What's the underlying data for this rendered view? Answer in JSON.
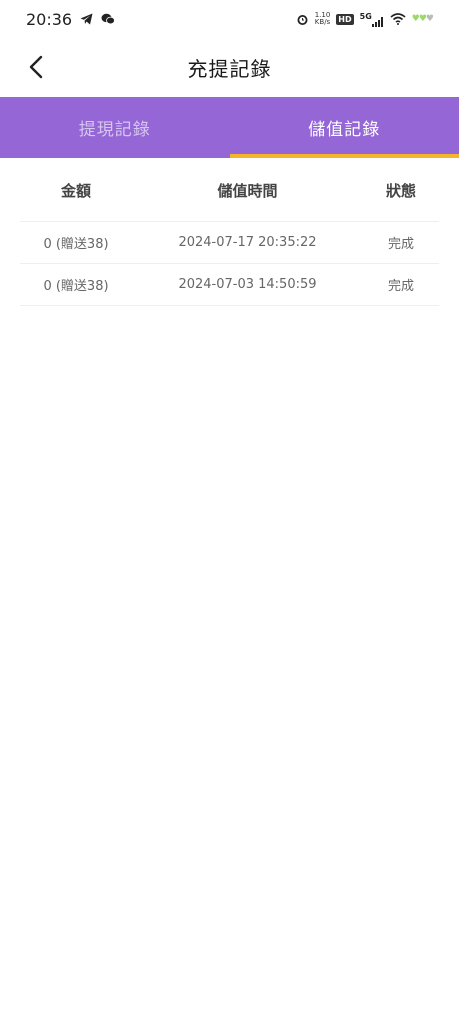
{
  "status_bar": {
    "time": "20:36",
    "net_speed_value": "1.10",
    "net_speed_unit": "KB/s",
    "hd_label": "HD",
    "signal_label": "5G"
  },
  "header": {
    "title": "充提記錄"
  },
  "tabs": [
    {
      "label": "提現記錄",
      "active": false
    },
    {
      "label": "儲值記錄",
      "active": true
    }
  ],
  "colors": {
    "tab_bar": "#9466d6",
    "tab_indicator": "#f5b52a"
  },
  "table": {
    "columns": [
      "金額",
      "儲值時間",
      "狀態"
    ],
    "rows": [
      {
        "amount": "0 (贈送38)",
        "time": "2024-07-17 20:35:22",
        "status": "完成"
      },
      {
        "amount": "0 (贈送38)",
        "time": "2024-07-03 14:50:59",
        "status": "完成"
      }
    ]
  }
}
